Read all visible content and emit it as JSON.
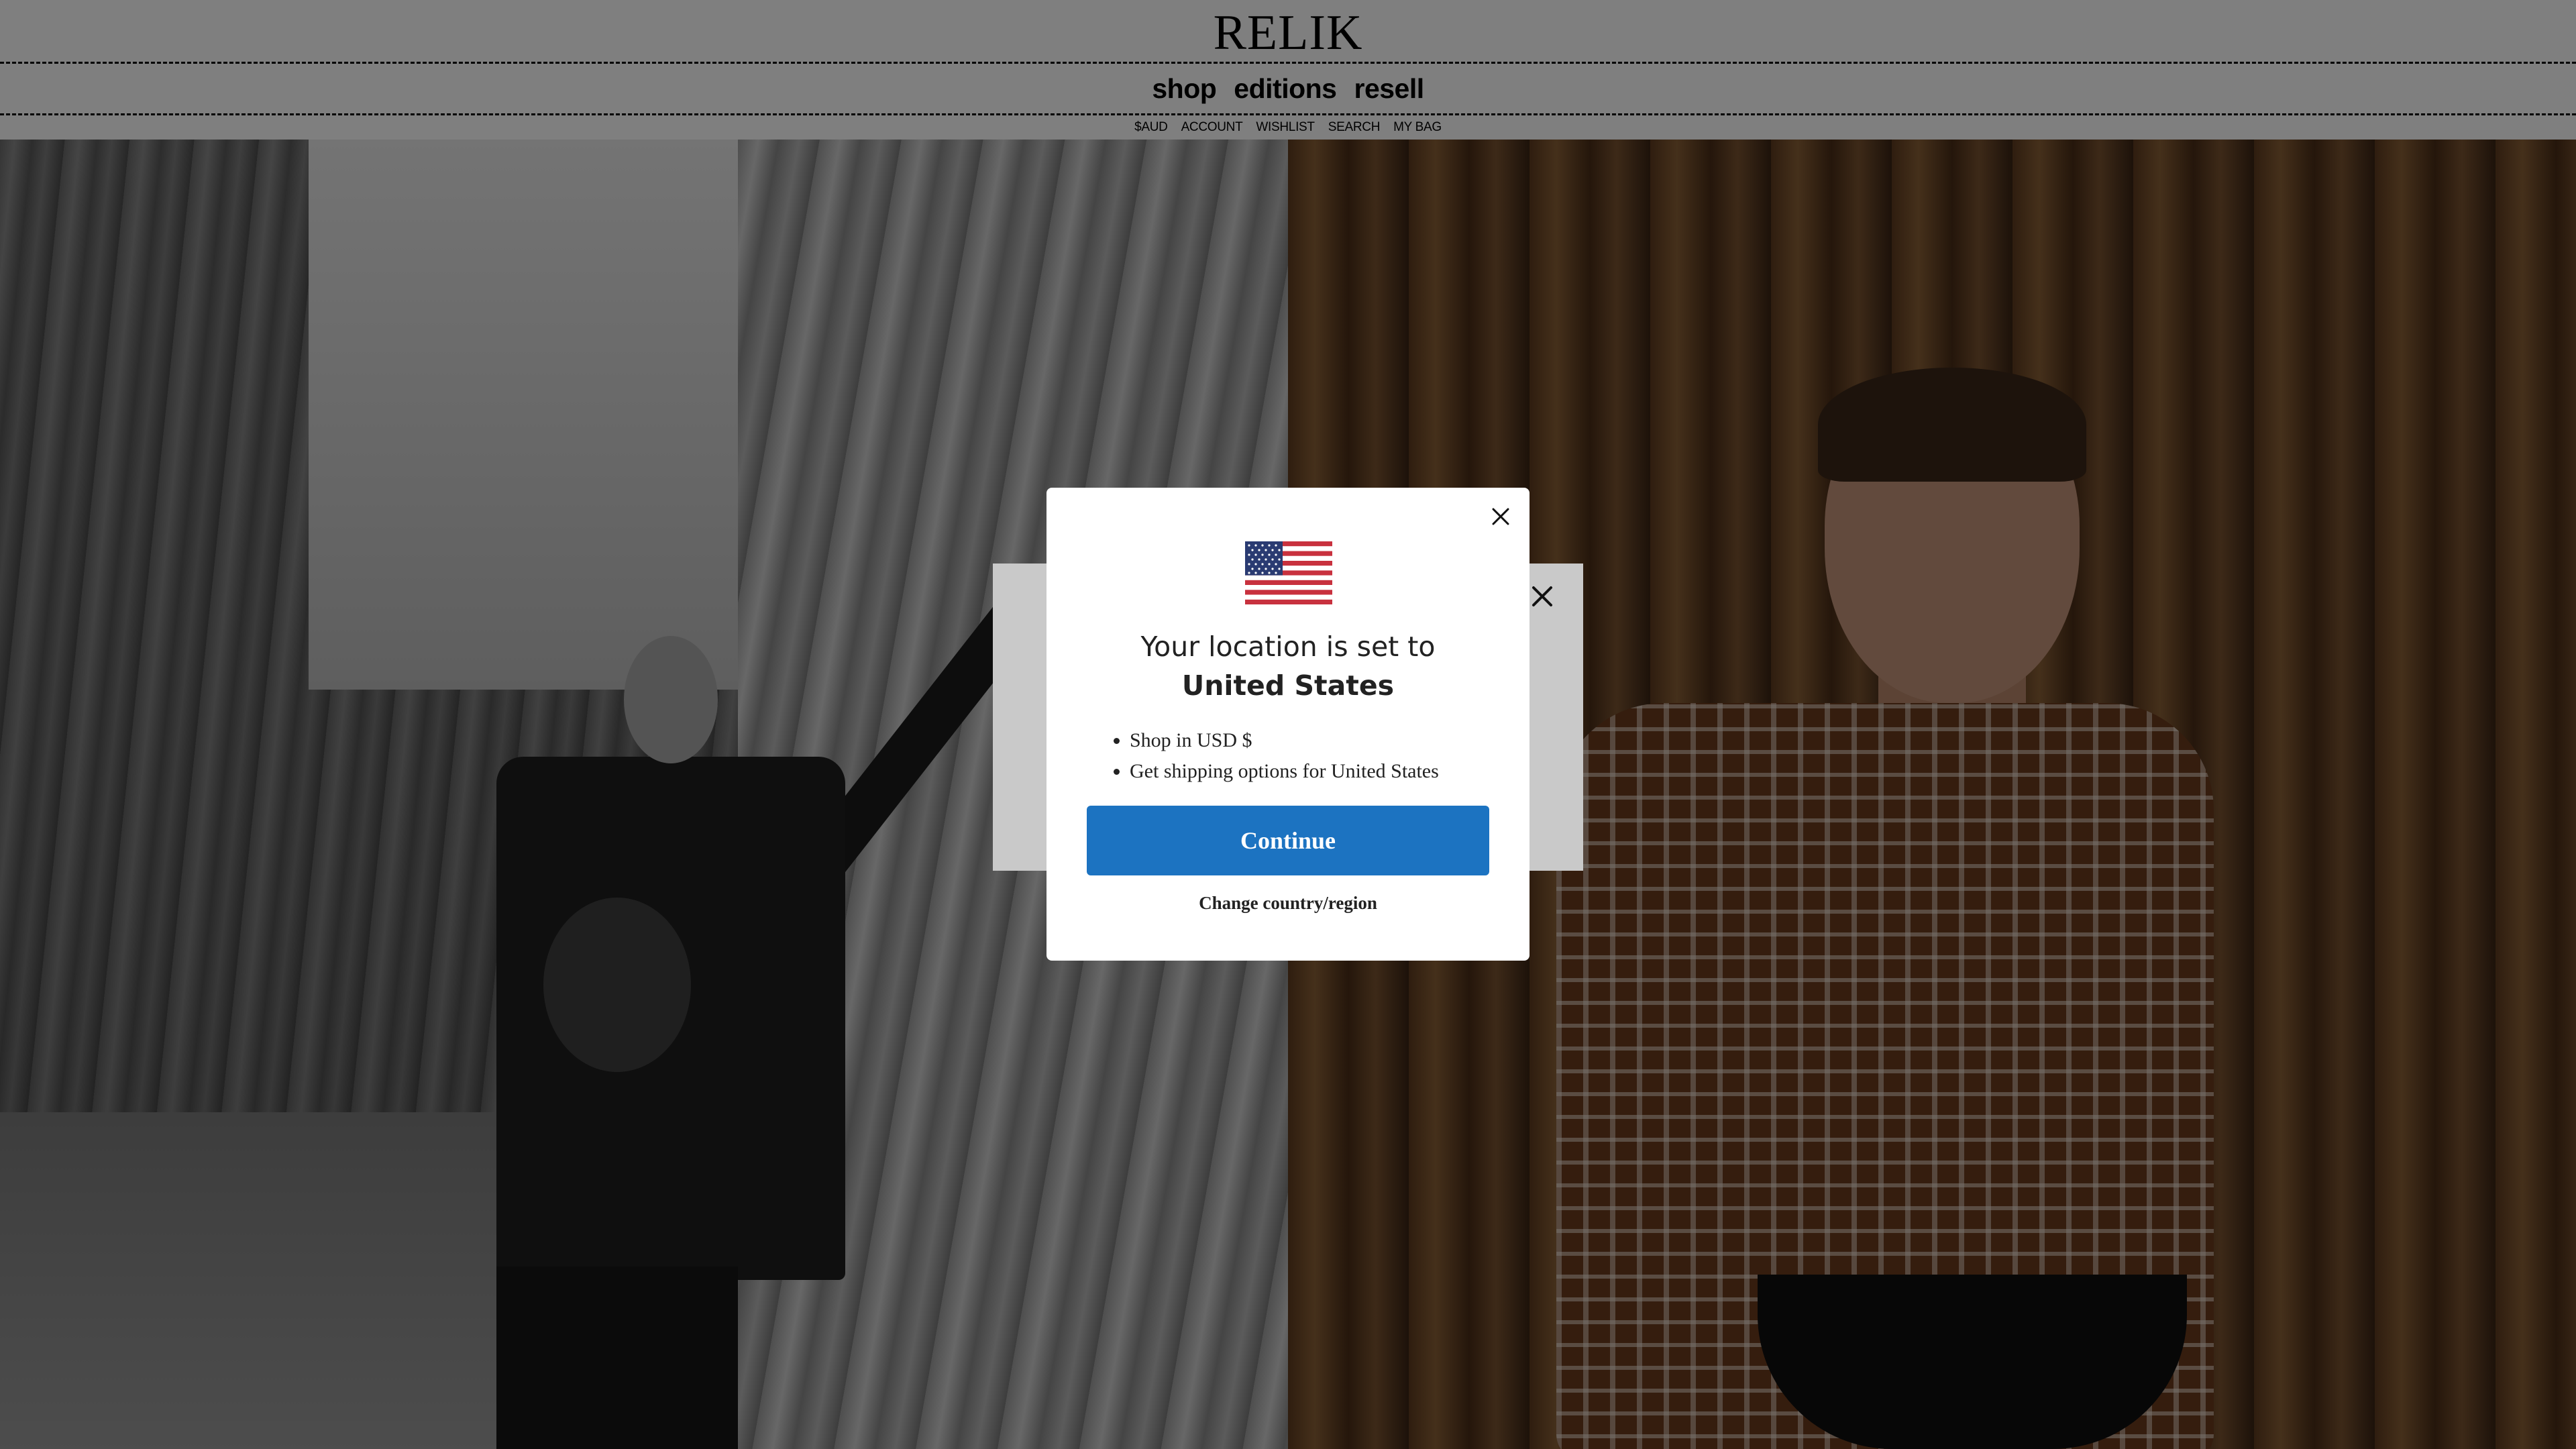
{
  "header": {
    "logo": "RELIK",
    "nav": [
      {
        "label": "shop"
      },
      {
        "label": "editions"
      },
      {
        "label": "resell"
      }
    ],
    "utility": [
      {
        "label": "$AUD"
      },
      {
        "label": "ACCOUNT"
      },
      {
        "label": "WISHLIST"
      },
      {
        "label": "SEARCH"
      },
      {
        "label": "MY BAG"
      }
    ]
  },
  "location_dialog": {
    "flag_icon": "us-flag-icon",
    "title_prefix": "Your location is set to",
    "title_country": "United States",
    "bullets": [
      "Shop in USD $",
      "Get shipping options for United States"
    ],
    "continue_label": "Continue",
    "change_label": "Change country/region",
    "close_icon": "close-icon"
  },
  "colors": {
    "primary_button": "#1c73c1",
    "overlay": "rgba(0,0,0,0.5)",
    "dialog_bg": "#ffffff"
  }
}
